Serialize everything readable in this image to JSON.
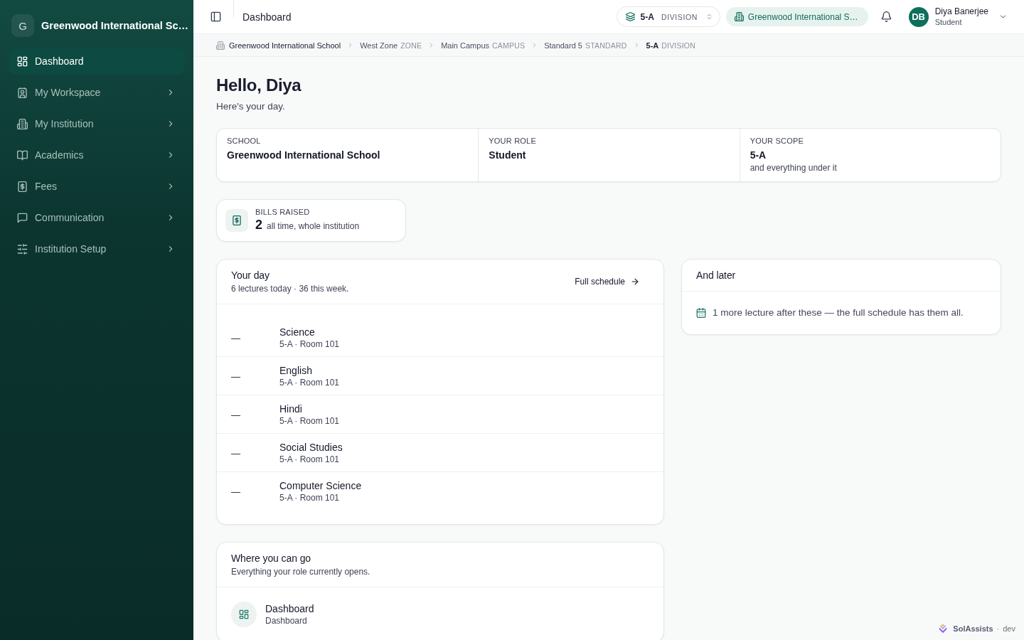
{
  "sidebar": {
    "brand": {
      "initial": "G",
      "name": "Greenwood International Sc…"
    },
    "items": [
      {
        "label": "Dashboard",
        "selected": true,
        "submenu": false
      },
      {
        "label": "My Workspace",
        "selected": false,
        "submenu": true
      },
      {
        "label": "My Institution",
        "selected": false,
        "submenu": true
      },
      {
        "label": "Academics",
        "selected": false,
        "submenu": true
      },
      {
        "label": "Fees",
        "selected": false,
        "submenu": true
      },
      {
        "label": "Communication",
        "selected": false,
        "submenu": true
      },
      {
        "label": "Institution Setup",
        "selected": false,
        "submenu": true
      }
    ]
  },
  "topbar": {
    "title": "Dashboard",
    "scope": {
      "code": "5-A",
      "kind": "DIVISION"
    },
    "school": "Greenwood International S…",
    "user": {
      "initials": "DB",
      "name": "Diya Banerjee",
      "role": "Student"
    }
  },
  "breadcrumbs": [
    {
      "name": "Greenwood International School",
      "current": false
    },
    {
      "name": "West Zone",
      "kind": "ZONE",
      "current": false
    },
    {
      "name": "Main Campus",
      "kind": "CAMPUS",
      "current": false
    },
    {
      "name": "Standard 5",
      "kind": "STANDARD",
      "current": false
    },
    {
      "name": "5-A",
      "kind": "DIVISION",
      "current": true
    }
  ],
  "greeting": {
    "title": "Hello, Diya",
    "subtitle": "Here's your day."
  },
  "summary": [
    {
      "label": "SCHOOL",
      "value": "Greenwood International School"
    },
    {
      "label": "YOUR ROLE",
      "value": "Student"
    },
    {
      "label": "YOUR SCOPE",
      "value": "5-A",
      "note": "and everything under it"
    }
  ],
  "stat": {
    "label": "BILLS RAISED",
    "value": "2",
    "note": "all time, whole institution"
  },
  "schedule": {
    "title": "Your day",
    "subtitle": "6 lectures today · 36 this week.",
    "link": "Full schedule",
    "rows": [
      {
        "time": "—",
        "subject": "Science",
        "detail": "5-A · Room 101"
      },
      {
        "time": "—",
        "subject": "English",
        "detail": "5-A · Room 101"
      },
      {
        "time": "—",
        "subject": "Hindi",
        "detail": "5-A · Room 101"
      },
      {
        "time": "—",
        "subject": "Social Studies",
        "detail": "5-A · Room 101"
      },
      {
        "time": "—",
        "subject": "Computer Science",
        "detail": "5-A · Room 101"
      }
    ]
  },
  "later": {
    "title": "And later",
    "message": "1 more lecture after these — the full schedule has them all."
  },
  "destinations": {
    "title": "Where you can go",
    "subtitle": "Everything your role currently opens.",
    "items": [
      {
        "title": "Dashboard",
        "subtitle": "Dashboard"
      }
    ]
  },
  "footer": {
    "brand": "SolAssists",
    "separator": "·",
    "env": "dev"
  }
}
